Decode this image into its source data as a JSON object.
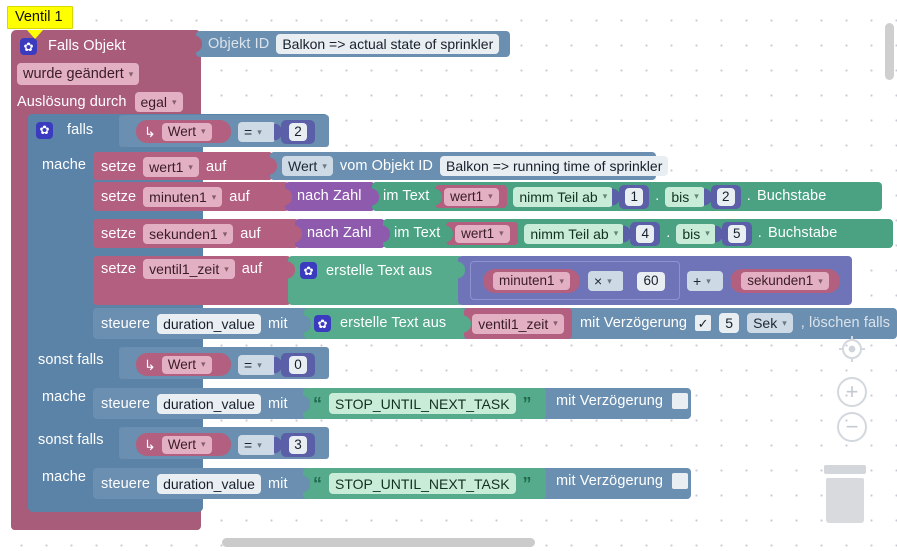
{
  "workspace": {
    "comment": "Ventil 1",
    "grid_color": "#c9c9d6",
    "background": "#ffffff"
  },
  "trigger_block": {
    "gear_icon": "gear-icon",
    "title": "Falls Objekt",
    "object_id_label": "Objekt ID",
    "object_id_value": "Balkon => actual state of sprinkler",
    "condition_dropdown": "wurde geändert",
    "trigger_by_label": "Auslösung durch",
    "trigger_by_dropdown": "egal",
    "color": "#a85c7a"
  },
  "if_block": {
    "gear_icon": "gear-icon",
    "if_label": "falls",
    "do_label": "mache",
    "elseif_label": "sonst falls",
    "color": "#5b83a8"
  },
  "branches": [
    {
      "condition": {
        "getter": "Wert",
        "operator": "=",
        "number": "2"
      }
    },
    {
      "condition": {
        "getter": "Wert",
        "operator": "=",
        "number": "0"
      }
    },
    {
      "condition": {
        "getter": "Wert",
        "operator": "=",
        "number": "3"
      }
    }
  ],
  "statements": {
    "set_label": "setze",
    "to_label": "auf",
    "wert1": {
      "variable": "wert1",
      "getter": "Wert",
      "from_object_label": "vom Objekt ID",
      "object_id": "Balkon => running time of sprinkler"
    },
    "minuten1": {
      "variable": "minuten1",
      "to_number_label": "nach Zahl",
      "in_text_label": "im Text",
      "text_variable": "wert1",
      "substring_label": "nimm Teil ab",
      "from_index": "1",
      "to_label": "bis",
      "to_index": "2",
      "letter_label": "Buchstabe",
      "dot": "."
    },
    "sekunden1": {
      "variable": "sekunden1",
      "to_number_label": "nach Zahl",
      "in_text_label": "im Text",
      "text_variable": "wert1",
      "substring_label": "nimm Teil ab",
      "from_index": "4",
      "to_label": "bis",
      "to_index": "5",
      "letter_label": "Buchstabe",
      "dot": "."
    },
    "ventil1_zeit": {
      "variable": "ventil1_zeit",
      "create_text_label": "erstelle Text aus",
      "gear_icon": "gear-icon",
      "left_variable": "minuten1",
      "mult_operator": "×",
      "mult_number": "60",
      "plus_operator": "+",
      "right_variable": "sekunden1"
    }
  },
  "control_rows": [
    {
      "control_label": "steuere",
      "target": "duration_value",
      "with_label": "mit",
      "gear_icon": "gear-icon",
      "create_text_label": "erstelle Text aus",
      "value_variable": "ventil1_zeit",
      "delay_label": "mit Verzögerung",
      "delay_checked": "✓",
      "delay_number": "5",
      "delay_unit": "Sek",
      "clear_label": ", löschen falls"
    },
    {
      "control_label": "steuere",
      "target": "duration_value",
      "with_label": "mit",
      "text_value": "STOP_UNTIL_NEXT_TASK",
      "quote_open": "“",
      "quote_close": "”",
      "delay_label": "mit Verzögerung",
      "delay_checked": ""
    },
    {
      "control_label": "steuere",
      "target": "duration_value",
      "with_label": "mit",
      "text_value": "STOP_UNTIL_NEXT_TASK",
      "quote_open": "“",
      "quote_close": "”",
      "delay_label": "mit Verzögerung",
      "delay_checked": ""
    }
  ],
  "workspace_controls": {
    "center_icon": "target-center-icon",
    "zoom_in": "+",
    "zoom_out": "−",
    "trash_icon": "trash-icon"
  }
}
